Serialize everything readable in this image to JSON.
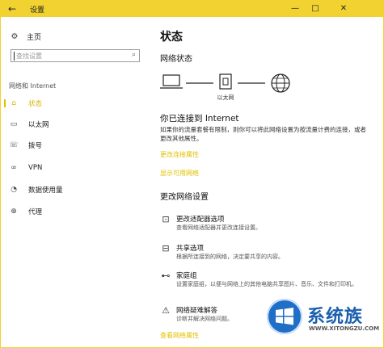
{
  "window": {
    "title": "设置",
    "back_icon": "arrow-left-icon",
    "controls": [
      "minimize",
      "maximize",
      "close"
    ]
  },
  "sidebar": {
    "home_label": "主页",
    "search_placeholder": "查找设置",
    "section_title": "网络和 Internet",
    "items": [
      {
        "label": "状态",
        "icon": "status-icon",
        "active": true
      },
      {
        "label": "以太网",
        "icon": "ethernet-icon",
        "active": false
      },
      {
        "label": "拨号",
        "icon": "dialup-icon",
        "active": false
      },
      {
        "label": "VPN",
        "icon": "vpn-icon",
        "active": false
      },
      {
        "label": "数据使用量",
        "icon": "data-usage-icon",
        "active": false
      },
      {
        "label": "代理",
        "icon": "proxy-icon",
        "active": false
      }
    ]
  },
  "main": {
    "title": "状态",
    "network_status_heading": "网络状态",
    "diagram_label": "以太网",
    "connected_title": "你已连接到 Internet",
    "connected_desc": "如果你的流量套餐有限制，则你可以将此网络设置为按流量计费的连接，或者更改其他属性。",
    "link_change_props": "更改连接属性",
    "link_show_networks": "显示可用网络",
    "change_settings_heading": "更改网络设置",
    "options": [
      {
        "title": "更改适配器选项",
        "desc": "查看网络适配器并更改连接设置。",
        "icon": "adapter-icon"
      },
      {
        "title": "共享选项",
        "desc": "根据所连接到的网络，决定要共享的内容。",
        "icon": "sharing-icon"
      },
      {
        "title": "家庭组",
        "desc": "设置家庭组，以便与网络上的其他电脑共享图片、音乐、文件和打印机。",
        "icon": "homegroup-icon"
      },
      {
        "title": "网络疑难解答",
        "desc": "诊断并解决网络问题。",
        "icon": "warning-icon"
      }
    ],
    "link_view_props": "查看网络属性"
  },
  "watermark": {
    "brand_text": "系统族",
    "url_text": "WWW.XITONGZU.COM"
  },
  "colors": {
    "accent": "#e2c000",
    "titlebar": "#f2d230"
  }
}
